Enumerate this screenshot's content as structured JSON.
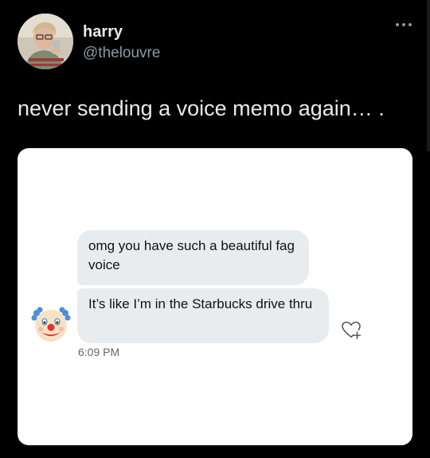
{
  "author": {
    "display_name": "harry",
    "handle": "@thelouvre",
    "avatar_icon": "user-photo-avatar"
  },
  "more_icon": "ellipsis-icon",
  "tweet": {
    "text": "never sending a voice memo again… ."
  },
  "chat": {
    "messages": [
      {
        "text": "omg you have such a beautiful fag voice"
      },
      {
        "text": "It’s like I’m in the Starbucks drive thru"
      }
    ],
    "sender_icon": "clown-face-icon",
    "timestamp": "6:09 PM",
    "reaction_icon": "heart-plus-icon"
  },
  "colors": {
    "background": "#000000",
    "card": "#ffffff",
    "bubble": "#e9ecef",
    "handle_text": "#8b98a5",
    "timestamp_text": "#666666"
  }
}
